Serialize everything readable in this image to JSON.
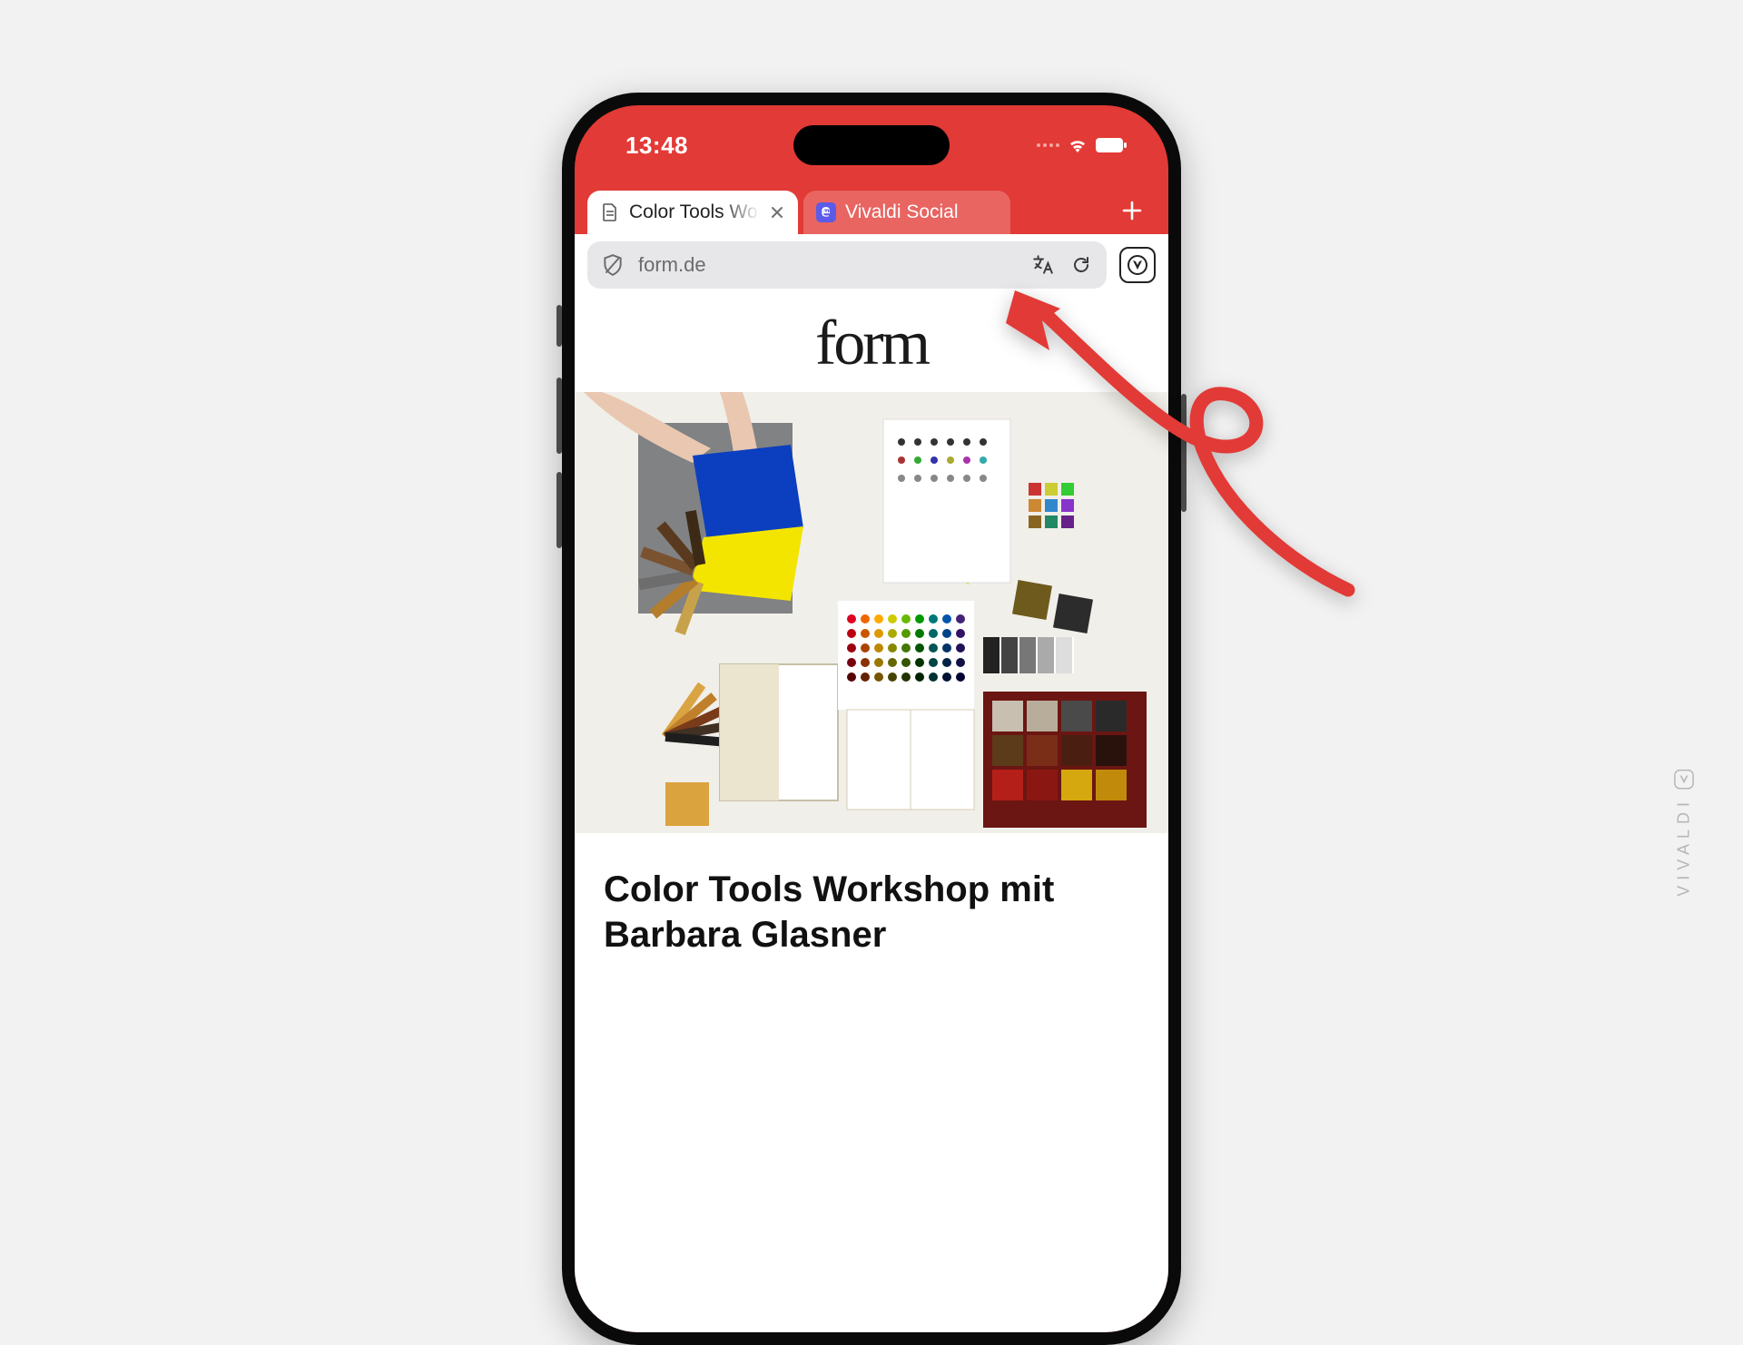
{
  "status": {
    "time": "13:48"
  },
  "tabs": {
    "active": {
      "label": "Color Tools Workshop mit Barbara Glasner"
    },
    "inactive": {
      "label": "Vivaldi Social"
    }
  },
  "address_bar": {
    "url": "form.de"
  },
  "page": {
    "logo": "form",
    "article_title": "Color Tools Workshop mit Barbara Glasner"
  },
  "brand": {
    "name": "VIVALDI"
  },
  "colors": {
    "accent": "#e23a36"
  }
}
